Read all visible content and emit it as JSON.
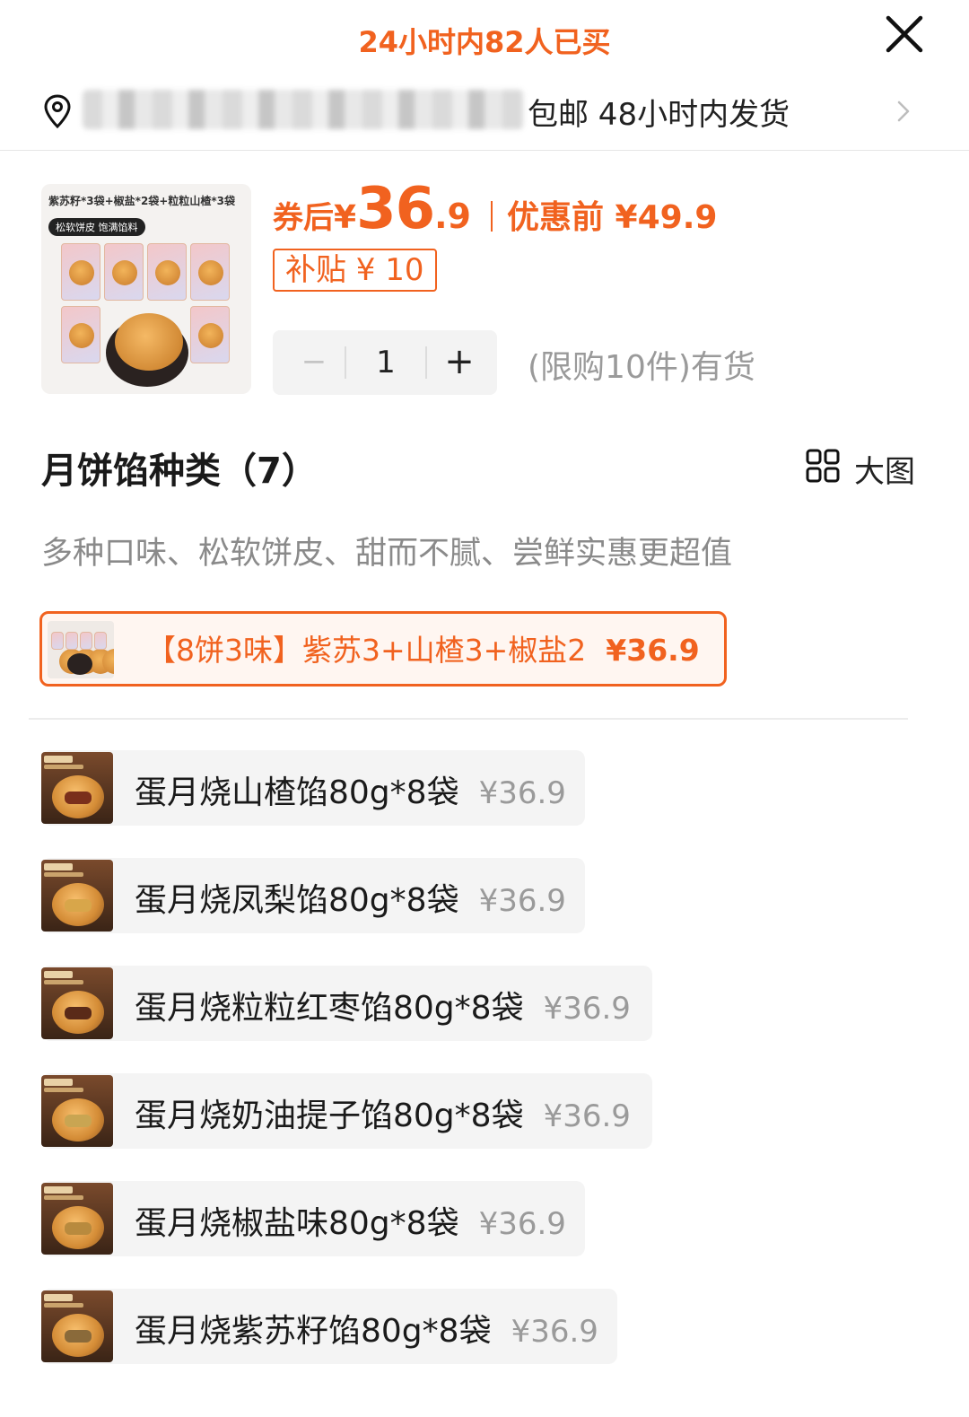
{
  "header": {
    "sold_text": "24小时内82人已买",
    "shipping_text": "包邮 48小时内发货"
  },
  "product": {
    "thumb_caption": "紫苏籽*3袋+椒盐*2袋+粒粒山楂*3袋",
    "thumb_tag": "松软饼皮 饱满馅料",
    "price_label": "券后",
    "price_yen": "¥",
    "price_int": "36",
    "price_dec": ".9",
    "price_before": "优惠前 ¥49.9",
    "subsidy": "补贴 ¥ 10"
  },
  "stepper": {
    "minus": "−",
    "value": "1",
    "plus": "+"
  },
  "stock_note": "(限购10件)有货",
  "section": {
    "title": "月饼馅种类（7）",
    "bigpic_label": "大图",
    "desc": "多种口味、松软饼皮、甜而不腻、尝鲜实惠更超值"
  },
  "selected_option": {
    "name": "【8饼3味】紫苏3+山楂3+椒盐2",
    "price": "¥36.9"
  },
  "options": [
    {
      "name": "蛋月烧山楂馅80g*8袋",
      "price": "¥36.9"
    },
    {
      "name": "蛋月烧凤梨馅80g*8袋",
      "price": "¥36.9"
    },
    {
      "name": "蛋月烧粒粒红枣馅80g*8袋",
      "price": "¥36.9"
    },
    {
      "name": "蛋月烧奶油提子馅80g*8袋",
      "price": "¥36.9"
    },
    {
      "name": "蛋月烧椒盐味80g*8袋",
      "price": "¥36.9"
    },
    {
      "name": "蛋月烧紫苏籽馅80g*8袋",
      "price": "¥36.9"
    }
  ],
  "colors": {
    "accent": "#f1621f",
    "muted": "#9a9a9a",
    "chip_bg": "#f4f4f4"
  },
  "icons": [
    "close-icon",
    "location-pin-icon",
    "chevron-right-icon",
    "grid-icon"
  ]
}
